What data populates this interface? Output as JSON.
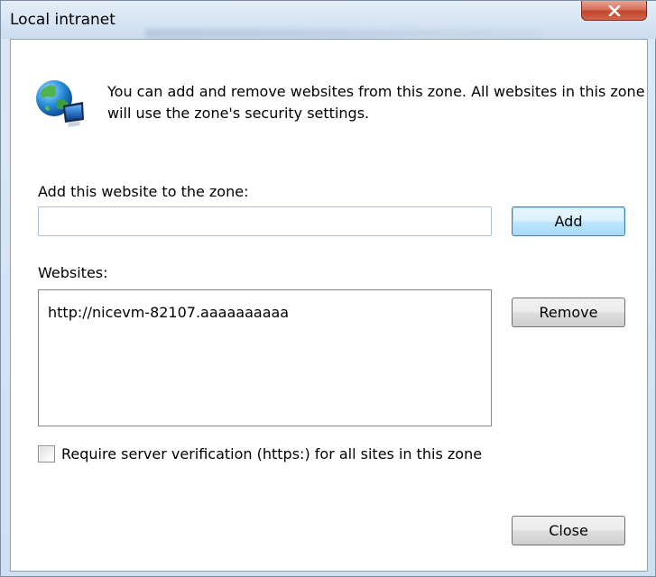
{
  "window": {
    "title": "Local intranet"
  },
  "info": {
    "text": "You can add and remove websites from this zone. All websites in this zone will use the zone's security settings.",
    "icon": "globe-computer-icon"
  },
  "add": {
    "label": "Add this website to the zone:",
    "input_value": "",
    "button_label": "Add"
  },
  "websites": {
    "label": "Websites:",
    "items": [
      "http://nicevm-82107.aaaaaaaaaa"
    ],
    "remove_label": "Remove"
  },
  "verification": {
    "label": "Require server verification (https:) for all sites in this zone",
    "checked": false
  },
  "footer": {
    "close_label": "Close"
  }
}
